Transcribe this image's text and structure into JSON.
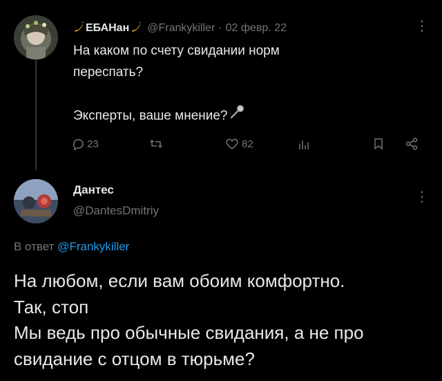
{
  "tweet": {
    "author_name": "ЕБАНан",
    "author_handle": "@Frankykiller",
    "separator": "·",
    "date": "02 февр. 22",
    "text_line1": "На каком по счету свидании норм",
    "text_line2": "переспать?",
    "text_line3": "Эксперты, ваше мнение?",
    "emoji_name": "microphone-emoji",
    "actions": {
      "replies": "23",
      "retweets": "",
      "likes": "82",
      "views": ""
    }
  },
  "reply": {
    "author_name": "Дантес",
    "author_handle": "@DantesDmitriy",
    "reply_to_prefix": "В ответ",
    "reply_to_handle": "@Frankykiller",
    "text_line1": "На любом, если вам обоим комфортно.",
    "text_line2": "Так, стоп",
    "text_line3": "Мы ведь про обычные свидания, а не про",
    "text_line4": "свидание с отцом в тюрьме?"
  },
  "colors": {
    "background": "#000000",
    "text": "#e7e9ea",
    "muted": "#71767b",
    "link": "#1d9bf0"
  },
  "icons": [
    "banana-icon",
    "reply-icon",
    "retweet-icon",
    "like-icon",
    "views-icon",
    "bookmark-icon",
    "share-icon",
    "more-icon"
  ]
}
